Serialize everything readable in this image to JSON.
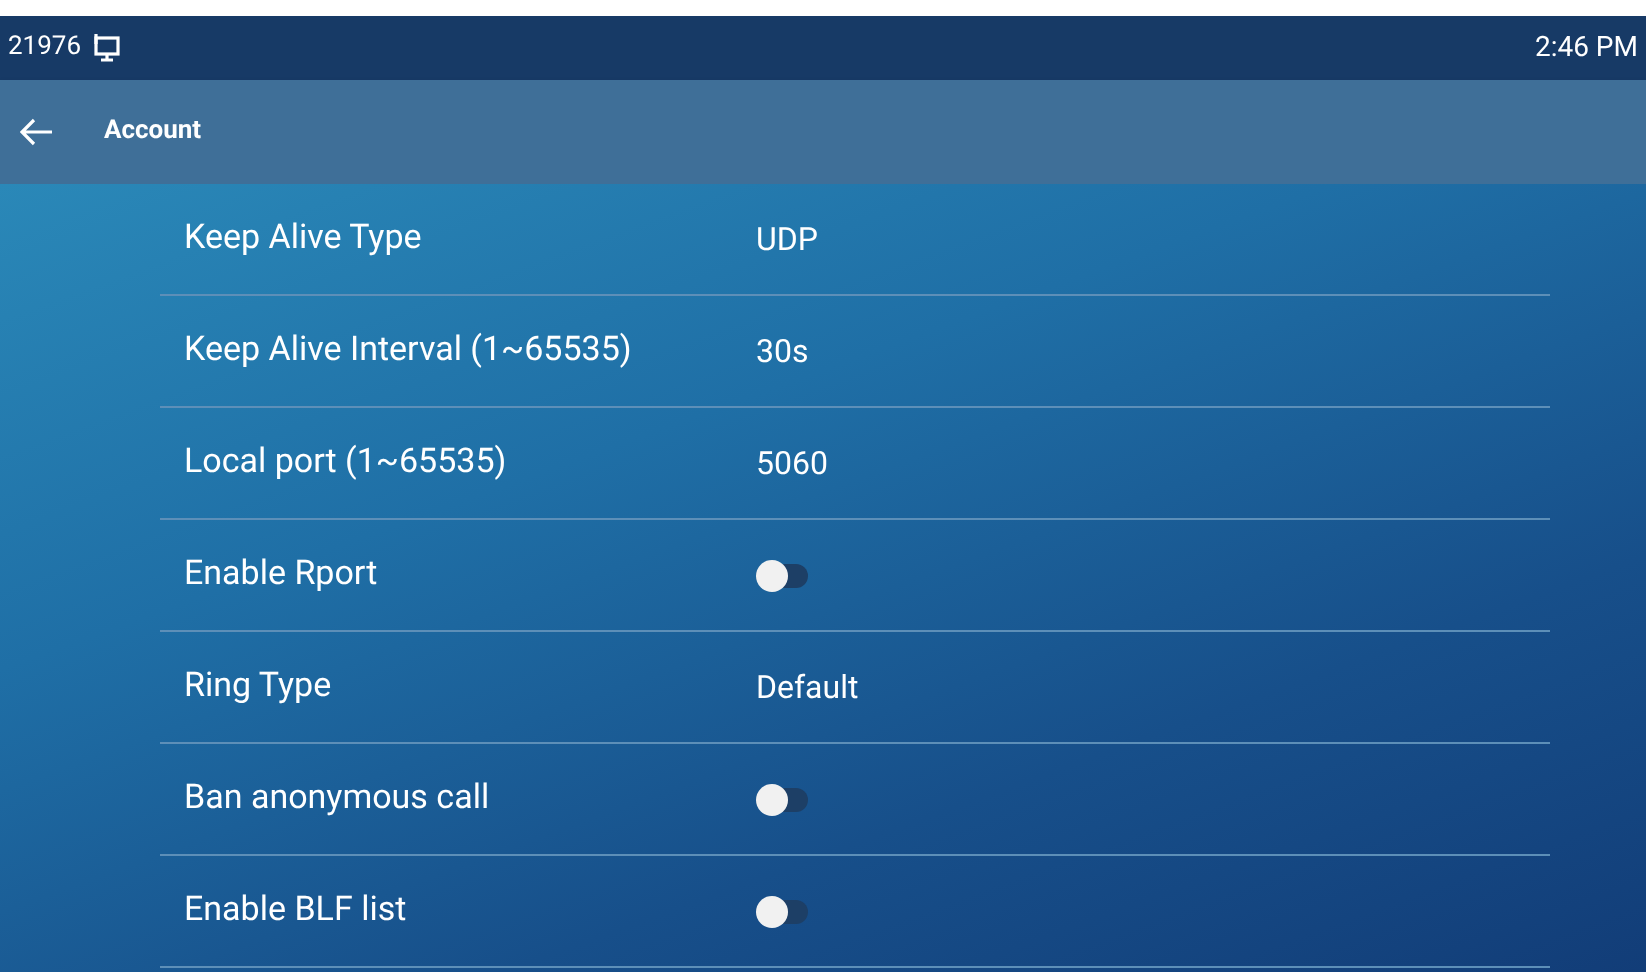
{
  "status_bar": {
    "extension": "21976",
    "time": "2:46 PM"
  },
  "header": {
    "title": "Account"
  },
  "rows": [
    {
      "kind": "value",
      "label": "Keep Alive Type",
      "value": "UDP"
    },
    {
      "kind": "value",
      "label": "Keep Alive Interval (1~65535)",
      "value": "30s"
    },
    {
      "kind": "value",
      "label": "Local port (1~65535)",
      "value": "5060"
    },
    {
      "kind": "toggle",
      "label": "Enable Rport",
      "on": false
    },
    {
      "kind": "value",
      "label": "Ring Type",
      "value": "Default"
    },
    {
      "kind": "toggle",
      "label": "Ban anonymous call",
      "on": false
    },
    {
      "kind": "toggle",
      "label": "Enable BLF list",
      "on": false
    }
  ]
}
